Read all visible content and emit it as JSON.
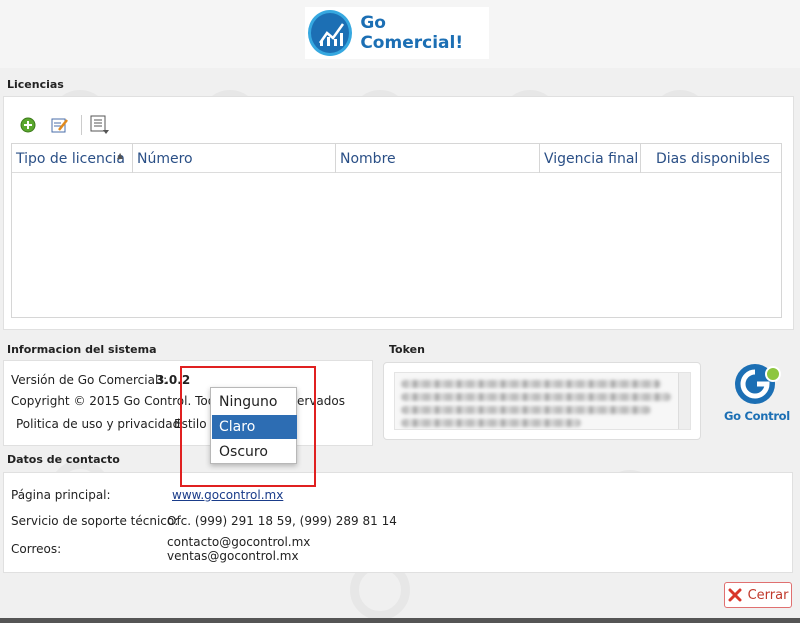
{
  "header": {
    "brand": "Go Comercial!"
  },
  "licencias": {
    "title": "Licencias",
    "toolbar": {
      "add_icon": "add-icon",
      "edit_icon": "edit-icon",
      "list_icon": "list-icon"
    },
    "columns": [
      "Tipo de licencia",
      "Número",
      "Nombre",
      "Vigencia final",
      "Dias disponibles"
    ],
    "rows": []
  },
  "sistema": {
    "title": "Informacion del sistema",
    "version_label": "Versión de Go Comercial!:",
    "version_value": "3.0.2",
    "copyright_left": "Copyright © 2015 Go Control. Todos",
    "copyright_right": "ervados",
    "policy": "Politica de uso y privacidad",
    "estilo_label": "Estilo"
  },
  "token": {
    "title": "Token"
  },
  "dropdown": {
    "options": [
      "Ninguno",
      "Claro",
      "Oscuro"
    ],
    "selected": "Claro"
  },
  "contacto": {
    "title": "Datos de contacto",
    "web_label": "Página principal:",
    "web_value": "www.gocontrol.mx",
    "soporte_label": "Servicio de soporte técnico:",
    "soporte_value": "Ofc. (999) 291 18 59, (999) 289 81 14",
    "correos_label": "Correos:",
    "correo1": "contacto@gocontrol.mx",
    "correo2": "ventas@gocontrol.mx"
  },
  "gocontrol_logo": {
    "text": "Go Control"
  },
  "footer": {
    "close_label": "Cerrar"
  },
  "colors": {
    "accent": "#2d6db3",
    "brand_blue": "#1c6fb4",
    "brand_green": "#8dc63f",
    "highlight": "#e02020",
    "close": "#c0392b"
  }
}
